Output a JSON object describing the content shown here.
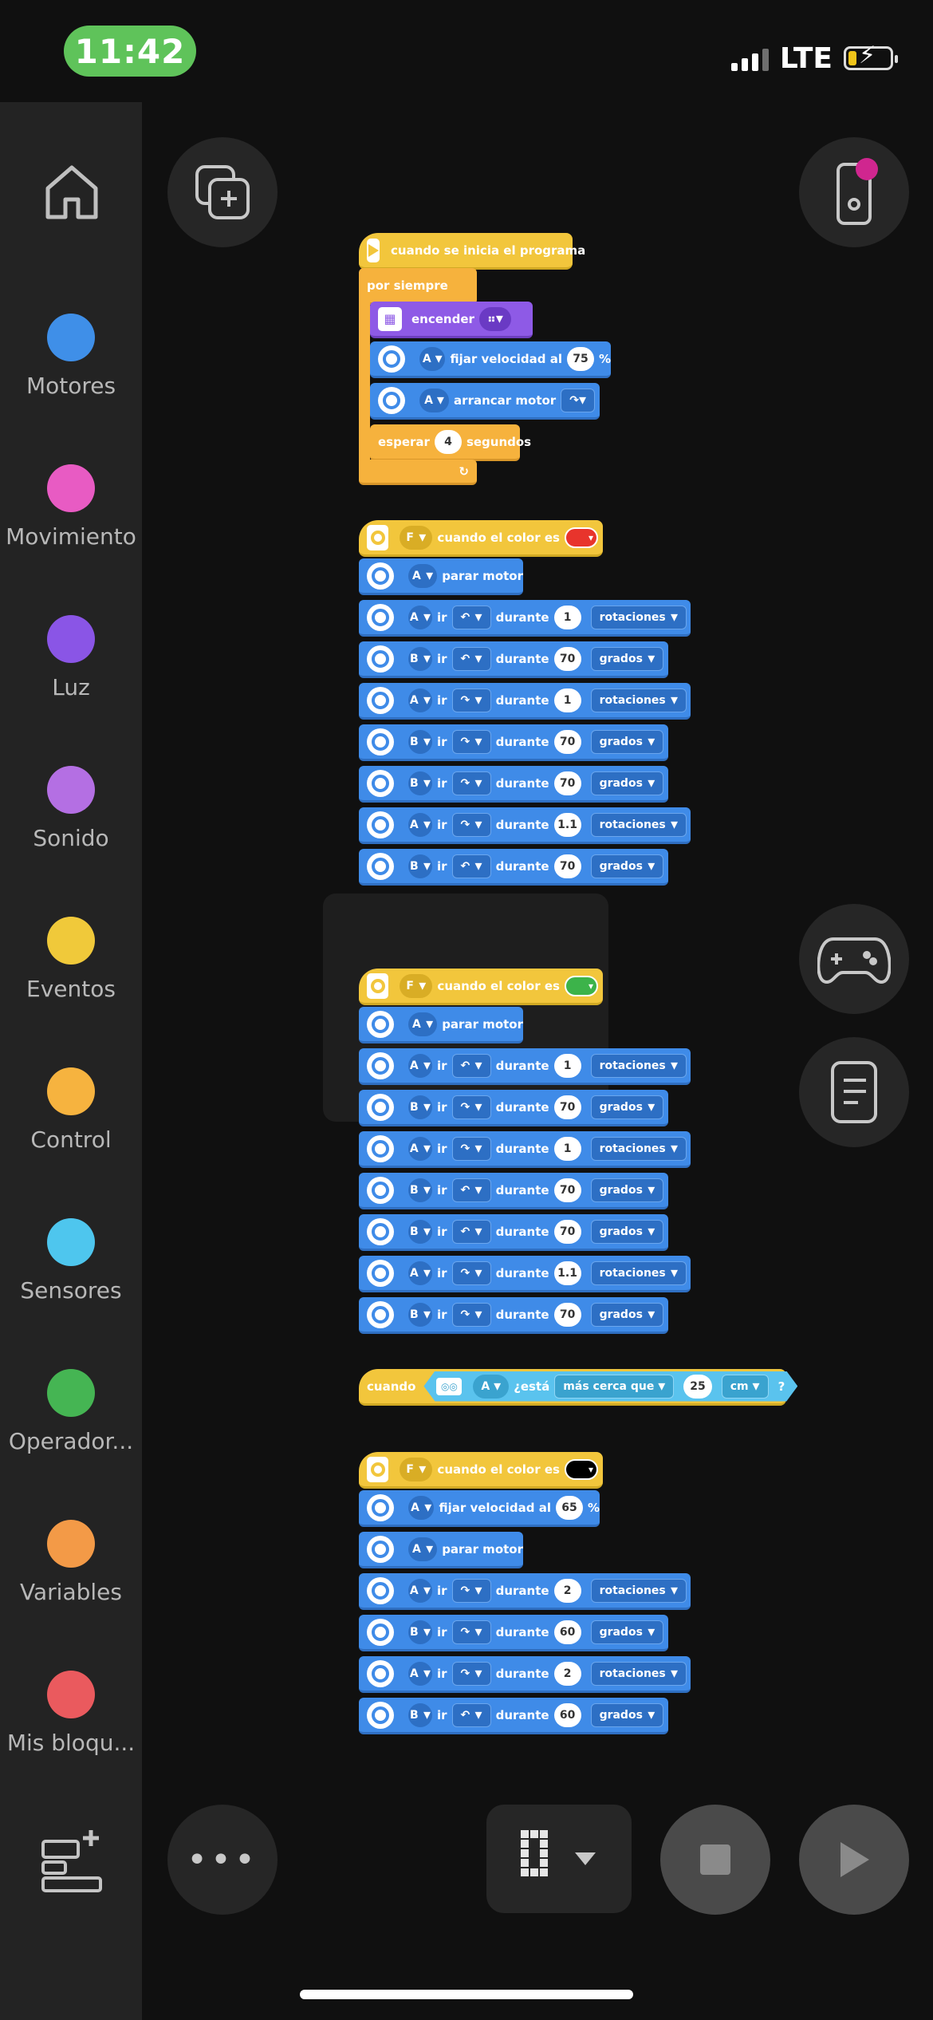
{
  "status_bar": {
    "time": "11:42",
    "network": "LTE"
  },
  "sidebar": {
    "categories": [
      {
        "label": "Motores",
        "color": "#3f8fe8"
      },
      {
        "label": "Movimiento",
        "color": "#e85bc3"
      },
      {
        "label": "Luz",
        "color": "#8a55e6"
      },
      {
        "label": "Sonido",
        "color": "#b46fe3"
      },
      {
        "label": "Eventos",
        "color": "#f0c93a"
      },
      {
        "label": "Control",
        "color": "#f6b33f"
      },
      {
        "label": "Sensores",
        "color": "#4ec6ee"
      },
      {
        "label": "Operador...",
        "color": "#45b553"
      },
      {
        "label": "Variables",
        "color": "#f39a47"
      },
      {
        "label": "Mis bloqu...",
        "color": "#ea5a5e"
      }
    ]
  },
  "program": {
    "stack1": {
      "hat": "cuando se inicia el programa",
      "forever": "por siempre",
      "light_on": "encender",
      "set_speed_port": "A",
      "set_speed_text": "fijar velocidad al",
      "set_speed_value": "75",
      "percent": "%",
      "start_port": "A",
      "start_text": "arrancar motor",
      "wait": "esperar",
      "wait_value": "4",
      "seconds": "segundos"
    },
    "stack2": {
      "port": "F",
      "hat_text": "cuando el color es",
      "color": "#e8342c",
      "stop_port": "A",
      "stop_text": "parar motor",
      "go": "ir",
      "during": "durante",
      "rows": [
        {
          "port": "A",
          "dir": "↶",
          "value": "1",
          "unit": "rotaciones"
        },
        {
          "port": "B",
          "dir": "↶",
          "value": "70",
          "unit": "grados"
        },
        {
          "port": "A",
          "dir": "↷",
          "value": "1",
          "unit": "rotaciones"
        },
        {
          "port": "B",
          "dir": "↷",
          "value": "70",
          "unit": "grados"
        },
        {
          "port": "B",
          "dir": "↷",
          "value": "70",
          "unit": "grados"
        },
        {
          "port": "A",
          "dir": "↷",
          "value": "1.1",
          "unit": "rotaciones"
        },
        {
          "port": "B",
          "dir": "↶",
          "value": "70",
          "unit": "grados"
        }
      ]
    },
    "stack3": {
      "port": "F",
      "hat_text": "cuando el color es",
      "color": "#3cb34a",
      "stop_port": "A",
      "stop_text": "parar motor",
      "go": "ir",
      "during": "durante",
      "rows": [
        {
          "port": "A",
          "dir": "↶",
          "value": "1",
          "unit": "rotaciones"
        },
        {
          "port": "B",
          "dir": "↷",
          "value": "70",
          "unit": "grados"
        },
        {
          "port": "A",
          "dir": "↷",
          "value": "1",
          "unit": "rotaciones"
        },
        {
          "port": "B",
          "dir": "↶",
          "value": "70",
          "unit": "grados"
        },
        {
          "port": "B",
          "dir": "↶",
          "value": "70",
          "unit": "grados"
        },
        {
          "port": "A",
          "dir": "↷",
          "value": "1.1",
          "unit": "rotaciones"
        },
        {
          "port": "B",
          "dir": "↷",
          "value": "70",
          "unit": "grados"
        }
      ]
    },
    "stack4": {
      "when": "cuando",
      "port": "A",
      "is_text": "¿está",
      "comparison": "más cerca que",
      "value": "25",
      "unit": "cm",
      "question": "?"
    },
    "stack5": {
      "port": "F",
      "hat_text": "cuando el color es",
      "color": "#000000",
      "speed_port": "A",
      "speed_text": "fijar velocidad al",
      "speed_value": "65",
      "percent": "%",
      "stop_port": "A",
      "stop_text": "parar motor",
      "go": "ir",
      "during": "durante",
      "rows": [
        {
          "port": "A",
          "dir": "↷",
          "value": "2",
          "unit": "rotaciones"
        },
        {
          "port": "B",
          "dir": "↷",
          "value": "60",
          "unit": "grados"
        },
        {
          "port": "A",
          "dir": "↷",
          "value": "2",
          "unit": "rotaciones"
        },
        {
          "port": "B",
          "dir": "↶",
          "value": "60",
          "unit": "grados"
        }
      ]
    }
  }
}
